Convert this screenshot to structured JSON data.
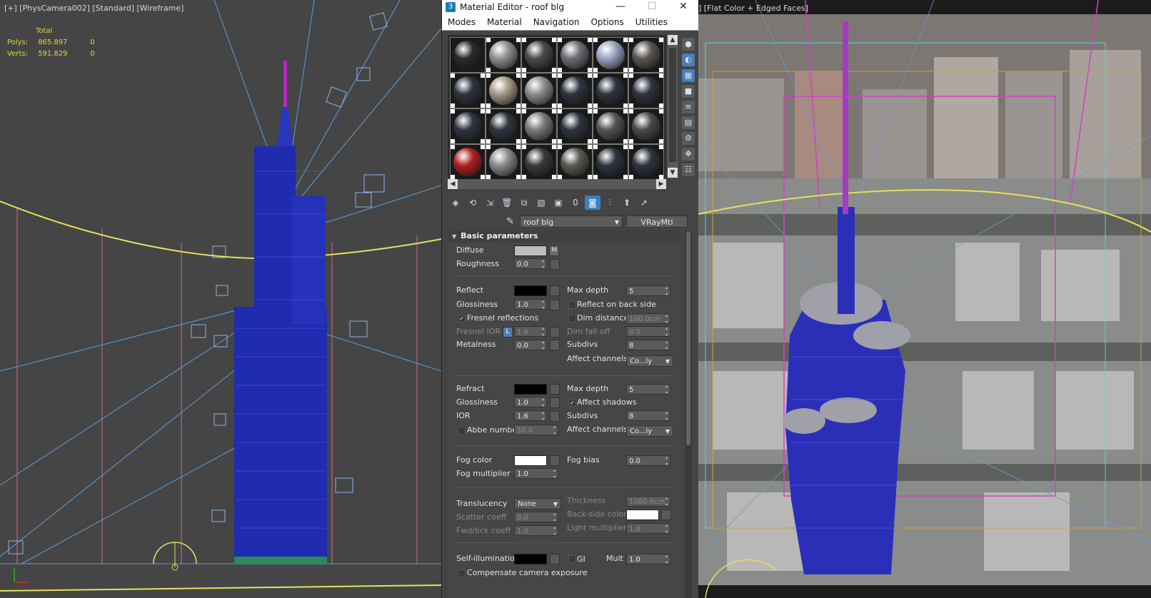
{
  "left_viewport": {
    "label": "[+] [PhysCamera002] [Standard] [Wireframe]",
    "stats": {
      "header": "Total",
      "polys_label": "Polys:",
      "polys_value": "865.897",
      "polys_sel": "0",
      "verts_label": "Verts:",
      "verts_value": "591.829",
      "verts_sel": "0"
    }
  },
  "right_viewport": {
    "label": "] [Flat Color + Edged Faces]"
  },
  "material_editor": {
    "title": "Material Editor - roof blg",
    "app_icon": "3",
    "window_buttons": {
      "minimize": "—",
      "maximize": "☐",
      "close": "✕"
    },
    "menu": [
      "Modes",
      "Material",
      "Navigation",
      "Options",
      "Utilities"
    ],
    "slot_colors": [
      [
        "#2a2a2a",
        "#8f8f8f",
        "#4a4a4a",
        "#6b6f73",
        "#9aa5c2",
        "#5a5550"
      ],
      [
        "#2e3440",
        "#a89a84",
        "#8c8c8c",
        "#2e3440",
        "#2e3440",
        "#2e3440"
      ],
      [
        "#2e3440",
        "#2e3440",
        "#7a7a7a",
        "#2e3440",
        "#555555",
        "#4a4a4a"
      ],
      [
        "#b02020",
        "#8a8a8a",
        "#3a3a3a",
        "#5a5a52",
        "#2e3440",
        "#2e3440"
      ]
    ],
    "material_name": "roof blg",
    "material_type": "VRayMtl",
    "rollout_title": "Basic parameters",
    "params": {
      "diffuse": "Diffuse",
      "diffuse_map": "M",
      "diffuse_color": "#bdbdbd",
      "roughness": "Roughness",
      "roughness_val": "0.0",
      "reflect": "Reflect",
      "reflect_color": "#000000",
      "glossiness": "Glossiness",
      "refl_gloss_val": "1.0",
      "fresnel": "Fresnel reflections",
      "fresnel_ior": "Fresnel IOR",
      "fresnel_ior_lock": "L",
      "fresnel_ior_val": "1.6",
      "metalness": "Metalness",
      "metalness_val": "0.0",
      "max_depth": "Max depth",
      "refl_max_depth_val": "5",
      "reflect_back": "Reflect on back side",
      "dim_distance": "Dim distance",
      "dim_distance_val": "100.0cm",
      "dim_falloff": "Dim fall off",
      "dim_falloff_val": "0.0",
      "subdivs": "Subdivs",
      "refl_subdivs_val": "8",
      "affect_channels": "Affect channels",
      "refl_affect_val": "Co...ly",
      "refract": "Refract",
      "refract_color": "#000000",
      "refr_gloss_val": "1.0",
      "ior": "IOR",
      "ior_val": "1.6",
      "abbe": "Abbe number",
      "abbe_val": "50.0",
      "refr_max_depth_val": "5",
      "affect_shadows": "Affect shadows",
      "refr_subdivs_val": "8",
      "refr_affect_val": "Co...ly",
      "fog_color": "Fog color",
      "fog_color_value": "#ffffff",
      "fog_multiplier": "Fog multiplier",
      "fog_multiplier_val": "1.0",
      "fog_bias": "Fog bias",
      "fog_bias_val": "0.0",
      "translucency": "Translucency",
      "translucency_val": "None",
      "scatter_coeff": "Scatter coeff",
      "scatter_coeff_val": "0.0",
      "fwd_bck": "Fwd/bck coeff",
      "fwd_bck_val": "1.0",
      "thickness": "Thickness",
      "thickness_val": "1000.0cm",
      "back_side_color": "Back-side color",
      "back_side_color_value": "#ffffff",
      "light_multiplier": "Light multiplier",
      "light_multiplier_val": "1.0",
      "self_illum": "Self-illumination",
      "self_illum_color": "#000000",
      "gi": "GI",
      "mult": "Mult",
      "mult_val": "1.0",
      "comp_cam": "Compensate camera exposure"
    }
  }
}
